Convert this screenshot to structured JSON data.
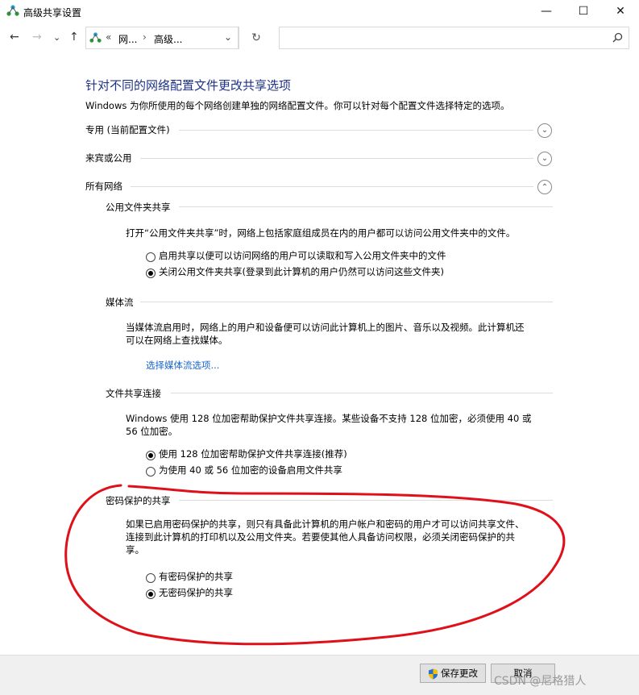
{
  "window": {
    "title": "高级共享设置",
    "minimize": "—",
    "maximize": "☐",
    "close": "✕"
  },
  "nav": {
    "back": "←",
    "forward": "→",
    "recent": "⌄",
    "up": "↑",
    "breadcrumb_prefix": "«",
    "breadcrumb_1": "网...",
    "breadcrumb_sep": "›",
    "breadcrumb_2": "高级...",
    "dropdown": "⌄",
    "refresh": "↻",
    "search_placeholder": ""
  },
  "main": {
    "heading": "针对不同的网络配置文件更改共享选项",
    "description": "Windows 为你所使用的每个网络创建单独的网络配置文件。你可以针对每个配置文件选择特定的选项。",
    "profiles": [
      {
        "label": "专用 (当前配置文件)",
        "state": "collapsed"
      },
      {
        "label": "来宾或公用",
        "state": "collapsed"
      },
      {
        "label": "所有网络",
        "state": "expanded"
      }
    ],
    "public_folder": {
      "title": "公用文件夹共享",
      "text": "打开“公用文件夹共享”时，网络上包括家庭组成员在内的用户都可以访问公用文件夹中的文件。",
      "option1": "启用共享以便可以访问网络的用户可以读取和写入公用文件夹中的文件",
      "option2": "关闭公用文件夹共享(登录到此计算机的用户仍然可以访问这些文件夹)",
      "selected": 2
    },
    "media": {
      "title": "媒体流",
      "text_line1": "当媒体流启用时，网络上的用户和设备便可以访问此计算机上的图片、音乐以及视频。此计算机还",
      "text_line2": "可以在网络上查找媒体。",
      "link": "选择媒体流选项..."
    },
    "file_sharing": {
      "title": "文件共享连接",
      "text_line1": "Windows 使用 128 位加密帮助保护文件共享连接。某些设备不支持 128 位加密，必须使用 40 或",
      "text_line2": "56 位加密。",
      "option1": "使用 128 位加密帮助保护文件共享连接(推荐)",
      "option2": "为使用 40 或 56 位加密的设备启用文件共享",
      "selected": 1
    },
    "password": {
      "title": "密码保护的共享",
      "text_line1": "如果已启用密码保护的共享，则只有具备此计算机的用户帐户和密码的用户才可以访问共享文件、",
      "text_line2": "连接到此计算机的打印机以及公用文件夹。若要使其他人具备访问权限，必须关闭密码保护的共",
      "text_line3": "享。",
      "option1": "有密码保护的共享",
      "option2": "无密码保护的共享",
      "selected": 2
    }
  },
  "footer": {
    "save_label": "保存更改",
    "cancel_label": "取消"
  },
  "watermark": "CSDN @尼格猎人",
  "colors": {
    "heading": "#1e3287",
    "link": "#1a64c8",
    "annotation": "#e0101a"
  }
}
